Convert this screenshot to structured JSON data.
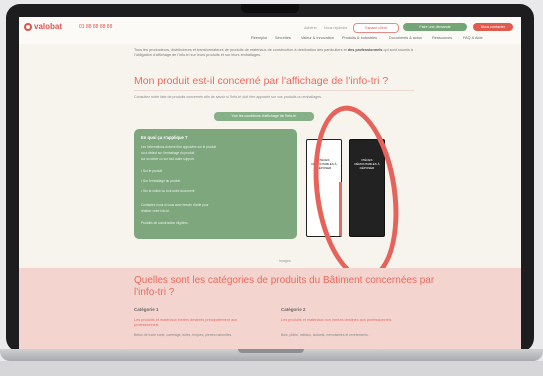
{
  "header": {
    "logo": "valobat",
    "phone": "01 88 88 88 88",
    "links": [
      "Adhérer",
      "Nous rejoindre"
    ],
    "buttons": {
      "espace": "Espace client",
      "demande": "Faire une demande",
      "contact": "Nous contacter"
    }
  },
  "nav": [
    "Réemploi",
    "Sécurités",
    "Valeur & Innovation",
    "Produits & Industries",
    "Documents & actus",
    "Ressources",
    "FAQ & Aide"
  ],
  "intro": {
    "lead": "Tous les producteurs, distributeurs et transformateurs de produits de matériaux de construction à destination des particuliers et",
    "bold": "des professionnels",
    "rest": "qui sont soumis à l'obligation d'affichage de l'info-tri sur leurs produits et sur leurs emballages."
  },
  "section1": {
    "title": "Mon produit est-il concerné par l'affichage de l'info-tri ?",
    "paragraph": "Consultez notre liste de produits concernés afin de savoir si l'info-tri doit être apposée sur vos produits ou emballages.",
    "button": "Voir les conditions d'affichage de l'info-tri"
  },
  "card": {
    "title": "En quoi ça s'applique ?",
    "lines": [
      "Les informations doivent être apposées sur le produit",
      "ou à défaut sur l'emballage du produit,",
      "sur la notice ou sur tout autre support.",
      "• Sur le produit",
      "• Sur l'emballage du produit",
      "• Sur la notice ou tout autre document",
      "Contactez-nous si vous avez besoin d'aide pour",
      "réaliser votre info-tri.",
      "Produits de construction éligibles."
    ]
  },
  "labels": {
    "left": "PIÈCES DÉMONTABLES À DÉPOSER",
    "right": "PIÈCES DÉMONTABLES À DÉPOSER"
  },
  "image_caption": "Images",
  "section2": {
    "title": "Quelles sont les catégories de produits du Bâtiment concernées par l'info-tri ?",
    "categories": [
      {
        "name": "Catégorie 1",
        "subtitle": "Les produits et matériaux inertes destinés principalement aux professionnels",
        "text": "Béton de toute sorte, carrelage, tuiles, briques, pierres naturelles."
      },
      {
        "name": "Catégorie 2",
        "subtitle": "Les produits et matériaux non inertes destinés aux professionnels",
        "text": "Bois, plâtre, métaux, isolants, menuiseries et revêtements."
      }
    ]
  },
  "accent_colors": {
    "brand": "#e0524f",
    "green": "#7ea77e",
    "highlight": "#e6625a"
  }
}
